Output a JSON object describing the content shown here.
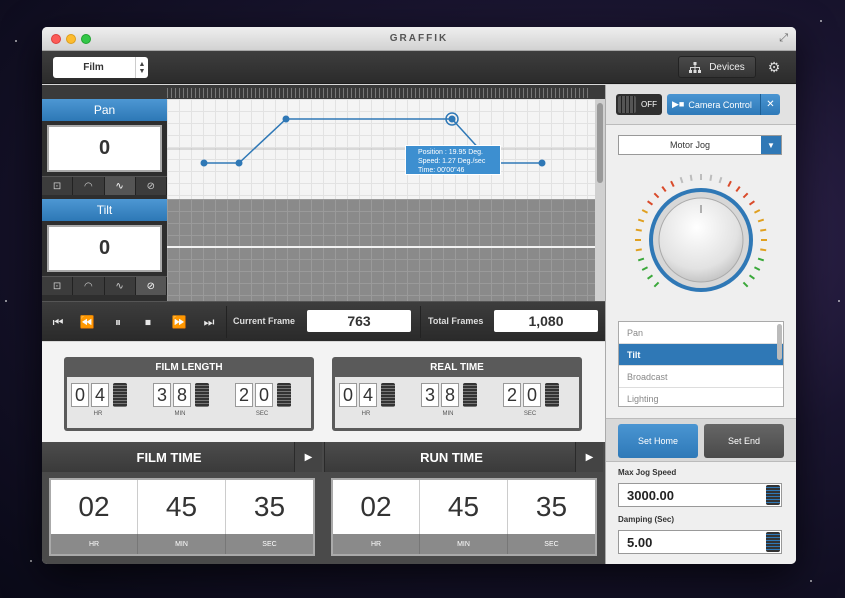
{
  "window": {
    "title": "GRAFFIK"
  },
  "toolbar": {
    "mode_value": "Film",
    "devices_label": "Devices"
  },
  "axes": [
    {
      "label": "Pan",
      "value": "0"
    },
    {
      "label": "Tilt",
      "value": "0"
    }
  ],
  "tooltip": {
    "line1": "Position : 19.95 Deg.",
    "line2": "Speed: 1.27 Deg./sec",
    "line3": "Time: 00'00\"46"
  },
  "transport": {
    "current_frame_label": "Current Frame",
    "current_frame_value": "763",
    "total_frames_label": "Total Frames",
    "total_frames_value": "1,080"
  },
  "film_length": {
    "title": "FILM LENGTH",
    "hr": [
      "0",
      "4"
    ],
    "min": [
      "3",
      "8"
    ],
    "sec": [
      "2",
      "0"
    ],
    "hr_label": "HR",
    "min_label": "MIN",
    "sec_label": "SEC"
  },
  "real_time": {
    "title": "REAL TIME",
    "hr": [
      "0",
      "4"
    ],
    "min": [
      "3",
      "8"
    ],
    "sec": [
      "2",
      "0"
    ],
    "hr_label": "HR",
    "min_label": "MIN",
    "sec_label": "SEC"
  },
  "film_time": {
    "title": "FILM TIME",
    "hr": "02",
    "min": "45",
    "sec": "35",
    "hr_label": "HR",
    "min_label": "MIN",
    "sec_label": "SEC"
  },
  "run_time": {
    "title": "RUN TIME",
    "hr": "02",
    "min": "45",
    "sec": "35",
    "hr_label": "HR",
    "min_label": "MIN",
    "sec_label": "SEC"
  },
  "right_panel": {
    "power_label": "OFF",
    "camera_control_label": "Camera Control",
    "motor_select_value": "Motor Jog",
    "axis_list": [
      "Pan",
      "Tilt",
      "Broadcast",
      "Lighting"
    ],
    "selected_axis": "Tilt",
    "set_home_label": "Set Home",
    "set_end_label": "Set End",
    "max_jog_speed_label": "Max Jog Speed",
    "max_jog_speed_value": "3000.00",
    "damping_label": "Damping (Sec)",
    "damping_value": "5.00"
  },
  "colors": {
    "accent": "#2f78b6",
    "toolbar": "#333333"
  }
}
